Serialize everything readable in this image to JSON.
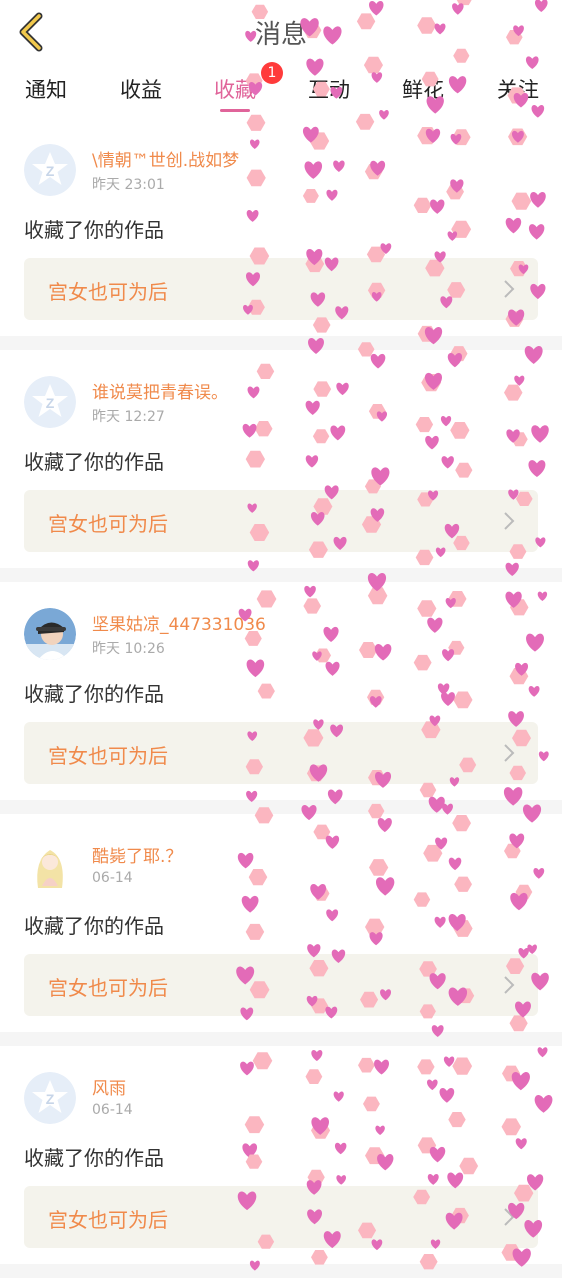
{
  "header": {
    "title": "消息"
  },
  "tabs": [
    {
      "label": "通知",
      "active": false
    },
    {
      "label": "收益",
      "active": false
    },
    {
      "label": "收藏",
      "active": true,
      "badge": "1"
    },
    {
      "label": "互动",
      "active": false
    },
    {
      "label": "鲜花",
      "active": false
    },
    {
      "label": "关注",
      "active": false
    }
  ],
  "items": [
    {
      "name": "\\情朝™世创.战如梦",
      "time": "昨天 23:01",
      "action": "收藏了你的作品",
      "work": "宫女也可为后",
      "avatar": "default-avatar"
    },
    {
      "name": "谁说莫把青春误。",
      "time": "昨天 12:27",
      "action": "收藏了你的作品",
      "work": "宫女也可为后",
      "avatar": "default-avatar"
    },
    {
      "name": "坚果姑凉_447331036",
      "time": "昨天 10:26",
      "action": "收藏了你的作品",
      "work": "宫女也可为后",
      "avatar": "photo-avatar"
    },
    {
      "name": "酷毙了耶.？",
      "time": "06-14",
      "action": "收藏了你的作品",
      "work": "宫女也可为后",
      "avatar": "anime-avatar"
    },
    {
      "name": "风雨",
      "time": "06-14",
      "action": "收藏了你的作品",
      "work": "宫女也可为后",
      "avatar": "default-avatar"
    }
  ],
  "colors": {
    "accent": "#e0649a",
    "name": "#f08a4b",
    "badge": "#ff3b3b",
    "work_bg": "#f4f3ec"
  }
}
